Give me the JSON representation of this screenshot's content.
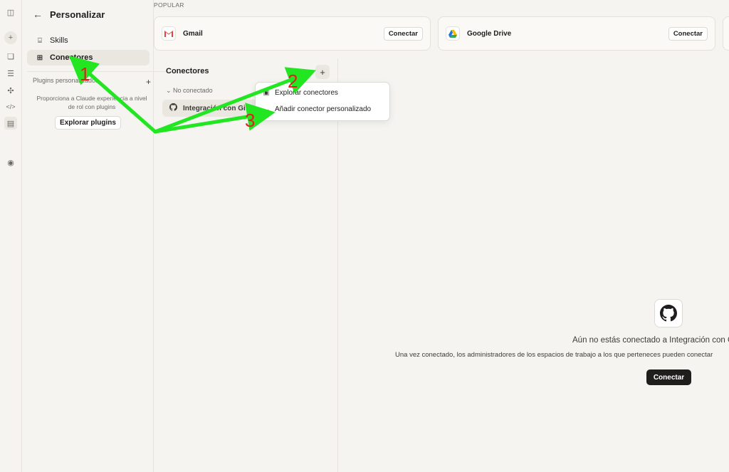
{
  "sidebar": {
    "back_icon": "arrow-left-icon",
    "title": "Personalizar",
    "items": [
      {
        "label": "Skills",
        "icon": "scroll-icon"
      },
      {
        "label": "Conectores",
        "icon": "grid-plus-icon"
      }
    ],
    "plugins_heading": "Plugins personalizados",
    "plugins_description": "Proporciona a Claude experiencia a nivel de rol con plugins",
    "explore_plugins_button": "Explorar plugins"
  },
  "popular": {
    "label": "POPULAR",
    "cards": [
      {
        "name": "Gmail",
        "button": "Conectar",
        "icon": "gmail-icon"
      },
      {
        "name": "Google Drive",
        "button": "Conectar",
        "icon": "google-drive-icon"
      }
    ]
  },
  "connectors": {
    "title": "Conectores",
    "group_label": "No conectado",
    "item_label": "Integración con GitHub",
    "item_icon": "github-icon"
  },
  "dropdown": {
    "items": [
      {
        "label": "Explorar conectores",
        "icon": "catalog-icon"
      },
      {
        "label": "Añadir conector personalizado",
        "icon": "more-horizontal-icon"
      }
    ]
  },
  "detail": {
    "title": "Aún no estás conectado a Integración con GitHub",
    "description": "Una vez conectado, los administradores de los espacios de trabajo a los que perteneces pueden conectar",
    "connect_button": "Conectar"
  },
  "annotations": {
    "labels": [
      "1",
      "2",
      "3"
    ],
    "arrow_color": "#22e622",
    "label_color": "#e02020"
  },
  "colors": {
    "background": "#f5f4f0",
    "primary_button": "#1f1e1d"
  }
}
